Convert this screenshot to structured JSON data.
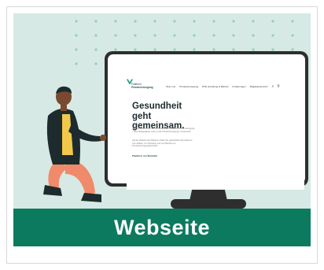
{
  "banner": {
    "label": "Webseite"
  },
  "website": {
    "logo": {
      "line1": "Plattform",
      "line2": "Primärversorgung"
    },
    "nav": [
      "Über uns",
      "Primärversorgung",
      "PVE Gründung & Betrieb",
      "Förderungen",
      "Mitgliederbereich"
    ],
    "headline": "Gesundheit geht gemeinsam.",
    "paragraph_1": "Herzlich willkommen auf der Website der Plattform Primärversorgung – dem Wegbegleiter rund um die Primärversorgung in Österreich.",
    "paragraph_2": "Auf der Website der Plattform finden Sie gebündelte Informationen zum Aufbau, zur Gründung und zum Betrieb von Primärversorgungseinheiten.",
    "cta": "Plattform im Überblick"
  },
  "colors": {
    "background": "#d6e9e4",
    "banner": "#0c7a5e",
    "dots": "#93cfc1",
    "monitor": "#2e2e2e"
  }
}
